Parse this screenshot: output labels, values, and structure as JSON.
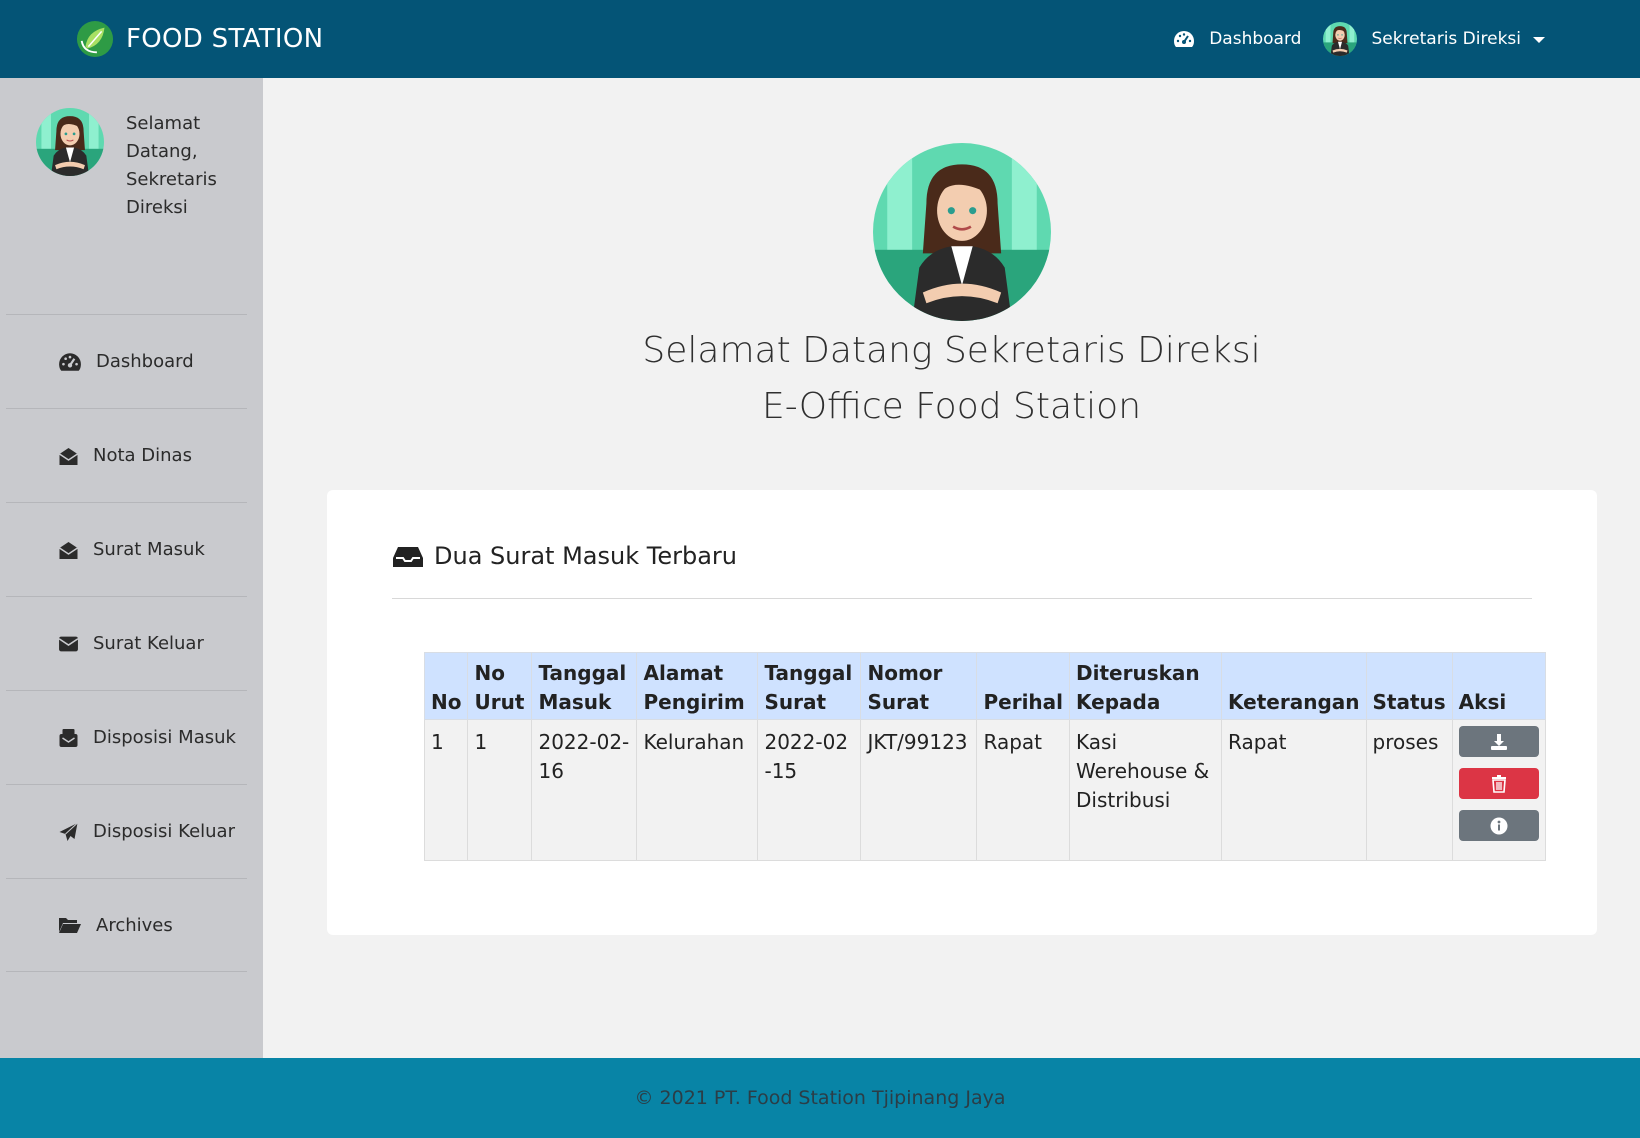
{
  "navbar": {
    "brand": "FOOD STATION",
    "dashboard_label": "Dashboard",
    "user_name": "Sekretaris Direksi"
  },
  "sidebar": {
    "welcome": "Selamat Datang, Sekretaris Direksi",
    "items": [
      {
        "label": "Dashboard",
        "icon": "gauge-icon"
      },
      {
        "label": "Nota Dinas",
        "icon": "envelope-open-icon"
      },
      {
        "label": "Surat Masuk",
        "icon": "envelope-open-icon"
      },
      {
        "label": "Surat Keluar",
        "icon": "envelope-icon"
      },
      {
        "label": "Disposisi Masuk",
        "icon": "mail-bulk-icon"
      },
      {
        "label": "Disposisi Keluar",
        "icon": "paper-plane-icon"
      },
      {
        "label": "Archives",
        "icon": "folder-open-icon"
      }
    ]
  },
  "hero": {
    "line1": "Selamat Datang Sekretaris Direksi",
    "line2": "E-Office Food Station"
  },
  "card": {
    "title": "Dua Surat Masuk Terbaru",
    "columns": [
      "No",
      "No Urut",
      "Tanggal Masuk",
      "Alamat Pengirim",
      "Tanggal Surat",
      "Nomor Surat",
      "Perihal",
      "Diteruskan Kepada",
      "Keterangan",
      "Status",
      "Aksi"
    ],
    "rows": [
      {
        "no": "1",
        "no_urut": "1",
        "tanggal_masuk": "2022-02-16",
        "alamat_pengirim": "Kelurahan",
        "tanggal_surat": "2022-02-15",
        "nomor_surat": "JKT/99123",
        "perihal": "Rapat",
        "diteruskan_kepada": "Kasi Werehouse & Distribusi",
        "keterangan": "Rapat",
        "status": "proses"
      }
    ]
  },
  "footer": {
    "text": "© 2021 PT. Food Station Tjipinang Jaya"
  },
  "colors": {
    "navbar": "#045476",
    "sidebar": "#c9cace",
    "footer": "#0884a6",
    "table_header": "#cfe2ff",
    "danger": "#dc3545",
    "secondary": "#6c757d"
  }
}
